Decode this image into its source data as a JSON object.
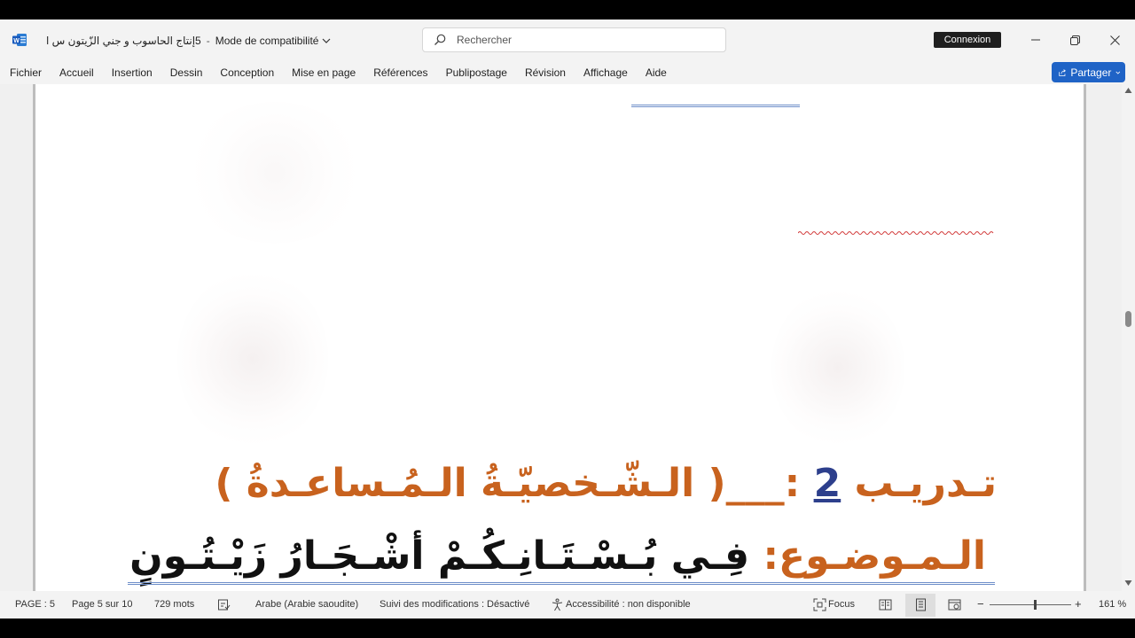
{
  "titlebar": {
    "doc_name": "5إنتاج الحاسوب و جني الزّيتون س ا",
    "separator": "-",
    "mode": "Mode de compatibilité",
    "search_placeholder": "Rechercher",
    "signin_label": "Connexion"
  },
  "menu": {
    "items": [
      "Fichier",
      "Accueil",
      "Insertion",
      "Dessin",
      "Conception",
      "Mise en page",
      "Références",
      "Publipostage",
      "Révision",
      "Affichage",
      "Aide"
    ],
    "share_label": "Partager"
  },
  "document": {
    "exercise_prefix": "تـدريـب",
    "exercise_number": "2",
    "exercise_suffix": ":___( الـشّـخصيّـةُ الـمُـساعـدةُ )",
    "topic_label": "الـمـوضـوع:",
    "topic_text": "فِـي بُـسْـتَـانِـكُـمْ أشْـجَـارُ زَيْـتُـونٍ"
  },
  "statusbar": {
    "page": "PAGE : 5",
    "page_of": "Page 5 sur 10",
    "words": "729 mots",
    "language": "Arabe (Arabie saoudite)",
    "track_changes": "Suivi des modifications : Désactivé",
    "accessibility": "Accessibilité : non disponible",
    "focus": "Focus",
    "zoom_minus": "−",
    "zoom_plus": "+",
    "zoom": "161 %"
  },
  "colors": {
    "accent": "#1f63c6",
    "heading_orange": "#c8621e",
    "number_blue": "#2d3f8c"
  },
  "icons": [
    "word-app-icon",
    "search-icon",
    "minimize-icon",
    "restore-icon",
    "close-icon",
    "share-icon",
    "proofing-icon",
    "accessibility-icon",
    "focus-icon",
    "read-mode-icon",
    "print-layout-icon",
    "web-layout-icon"
  ]
}
